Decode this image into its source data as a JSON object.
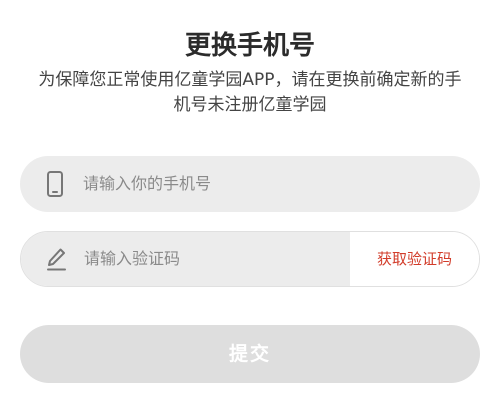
{
  "header": {
    "title": "更换手机号",
    "description_line1": "为保障您正常使用亿童学园APP，请在更换前确定新的手",
    "description_line2": "机号未注册亿童学园"
  },
  "form": {
    "phone": {
      "placeholder": "请输入你的手机号",
      "icon": "mobile-phone-icon"
    },
    "code": {
      "placeholder": "请输入验证码",
      "icon": "pencil-icon",
      "get_code_label": "获取验证码"
    },
    "submit_label": "提交"
  },
  "colors": {
    "accent": "#d23c2a",
    "field_bg": "#ececec",
    "submit_disabled_bg": "#dedede"
  }
}
